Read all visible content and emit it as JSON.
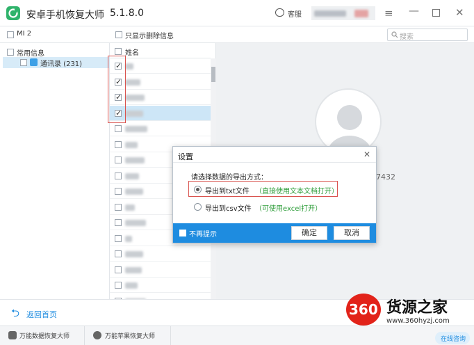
{
  "app": {
    "title": "安卓手机恢复大师",
    "version": "5.1.8.0",
    "service_label": "客服",
    "username_masked": "手机账号"
  },
  "toolbar": {
    "device_label": "MI 2",
    "show_deleted_label": "只显示删除信息",
    "search_placeholder": "搜索"
  },
  "sidebar": {
    "group_label": "常用信息",
    "items": [
      {
        "label": "通讯录 (231)"
      }
    ]
  },
  "list": {
    "header": "姓名",
    "rows": [
      {
        "checked": true,
        "selected": false
      },
      {
        "checked": true,
        "selected": false
      },
      {
        "checked": true,
        "selected": false
      },
      {
        "checked": true,
        "selected": true
      },
      {
        "checked": false,
        "selected": false
      },
      {
        "checked": false,
        "selected": false
      },
      {
        "checked": false,
        "selected": false
      },
      {
        "checked": false,
        "selected": false
      },
      {
        "checked": false,
        "selected": false
      },
      {
        "checked": false,
        "selected": false
      },
      {
        "checked": false,
        "selected": false
      },
      {
        "checked": false,
        "selected": false
      },
      {
        "checked": false,
        "selected": false
      },
      {
        "checked": false,
        "selected": false
      },
      {
        "checked": false,
        "selected": false
      },
      {
        "checked": false,
        "selected": false
      },
      {
        "checked": false,
        "selected": false
      }
    ]
  },
  "detail": {
    "phone_fragment": "7432"
  },
  "dialog": {
    "title": "设置",
    "prompt": "请选择数据的导出方式：",
    "option_txt": {
      "label": "导出到txt文件",
      "hint": "（直接使用文本文档打开）",
      "selected": true
    },
    "option_csv": {
      "label": "导出到csv文件",
      "hint": "（可使用excel打开）",
      "selected": false
    },
    "dont_show_label": "不再提示",
    "ok_label": "确定",
    "cancel_label": "取消"
  },
  "footer": {
    "back_label": "返回首页"
  },
  "status": {
    "tab1": "万能数据恢复大师",
    "tab2": "万能苹果恢复大师",
    "online_label": "在线咨询"
  },
  "watermark": {
    "logo_text": "360",
    "site_name": "货源之家",
    "url": "www.360hyzj.com"
  },
  "colors": {
    "accent": "#1e8ce0",
    "highlight_box": "#d9534f",
    "green_hint": "#2e9d3a",
    "logo_red": "#e2231a"
  }
}
